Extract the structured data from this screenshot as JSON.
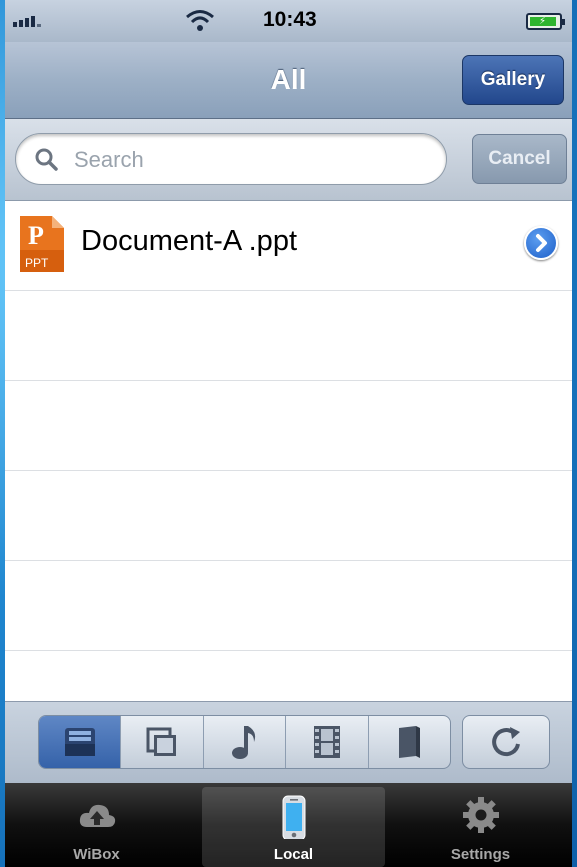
{
  "status_bar": {
    "time": "10:43"
  },
  "nav": {
    "title": "All",
    "gallery_label": "Gallery"
  },
  "search": {
    "placeholder": "Search",
    "cancel_label": "Cancel"
  },
  "files": [
    {
      "name": "Document-A .ppt",
      "icon": "ppt-file-icon",
      "icon_text": "PPT"
    }
  ],
  "filter_toolbar": {
    "segments": [
      "all-files-icon",
      "photos-icon",
      "music-icon",
      "video-icon",
      "book-icon"
    ],
    "selected": "all-files-icon",
    "refresh_icon": "refresh-icon"
  },
  "tabbar": {
    "tabs": [
      {
        "label": "WiBox",
        "icon": "cloud-upload-icon"
      },
      {
        "label": "Local",
        "icon": "phone-icon"
      },
      {
        "label": "Settings",
        "icon": "gear-icon"
      }
    ],
    "selected": "Local"
  },
  "colors": {
    "accent": "#3562a9",
    "nav": "#9db0c6",
    "toolbar": "#aebbcb",
    "tabbar": "#101010"
  }
}
